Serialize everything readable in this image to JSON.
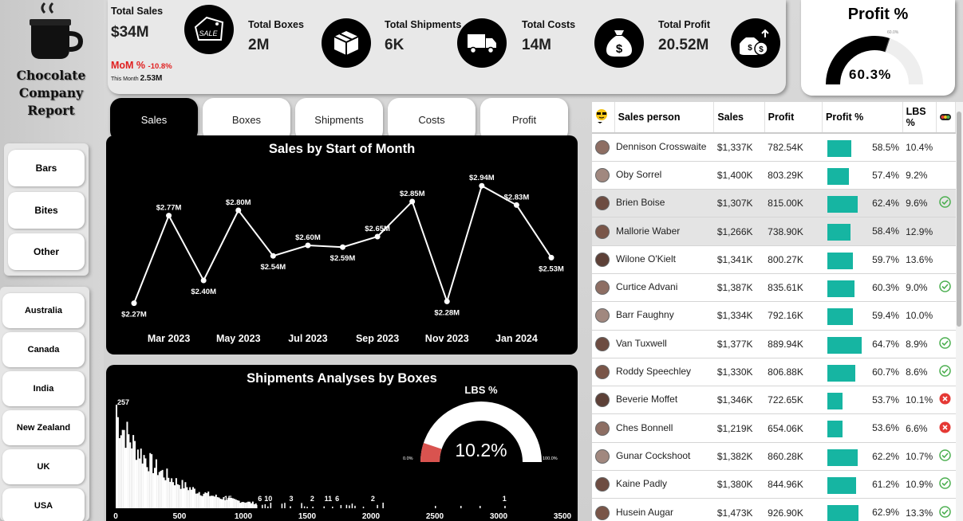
{
  "report": {
    "title_line1": "Chocolate",
    "title_line2": "Company",
    "title_line3": "Report"
  },
  "categories": [
    "Bars",
    "Bites",
    "Other"
  ],
  "countries": [
    "Australia",
    "Canada",
    "India",
    "New Zealand",
    "UK",
    "USA"
  ],
  "kpis": {
    "total_sales_label": "Total Sales",
    "total_sales_value": "$34M",
    "sale_icon_text": "SALE",
    "mom_label": "MoM %",
    "mom_value": "-10.8%",
    "this_month_label": "This Month",
    "this_month_value": "2.53M",
    "total_boxes_label": "Total Boxes",
    "total_boxes_value": "2M",
    "total_shipments_label": "Total Shipments",
    "total_shipments_value": "6K",
    "total_costs_label": "Total Costs",
    "total_costs_value": "14M",
    "total_profit_label": "Total Profit",
    "total_profit_value": "20.52M"
  },
  "profit_gauge": {
    "title": "Profit %",
    "value_label": "60.3%",
    "target_label": "60.0%",
    "value": 0.603
  },
  "tabs": [
    "Sales",
    "Boxes",
    "Shipments",
    "Costs",
    "Profit"
  ],
  "colors": {
    "accent": "#16b5a2",
    "negative": "#e02020",
    "gauge_red": "#d9534f",
    "positive_icon": "#4caf50",
    "negative_icon": "#e53935"
  },
  "chart_data": [
    {
      "type": "line",
      "title": "Sales by Start of Month",
      "x": [
        "Feb 2023",
        "Mar 2023",
        "Apr 2023",
        "May 2023",
        "Jun 2023",
        "Jul 2023",
        "Aug 2023",
        "Sep 2023",
        "Oct 2023",
        "Nov 2023",
        "Dec 2023",
        "Jan 2024",
        "Feb 2024"
      ],
      "values": [
        2.27,
        2.77,
        2.4,
        2.8,
        2.54,
        2.6,
        2.59,
        2.65,
        2.85,
        2.28,
        2.94,
        2.83,
        2.53
      ],
      "data_labels": [
        "$2.27M",
        "$2.77M",
        "$2.40M",
        "$2.80M",
        "$2.54M",
        "$2.60M",
        "$2.59M",
        "$2.65M",
        "$2.85M",
        "$2.28M",
        "$2.94M",
        "$2.83M",
        "$2.53M"
      ],
      "tick_labels": [
        "Mar 2023",
        "May 2023",
        "Jul 2023",
        "Sep 2023",
        "Nov 2023",
        "Jan 2024"
      ],
      "ylim": [
        2.2,
        3.0
      ]
    },
    {
      "type": "bar",
      "title": "Shipments Analyses by Boxes",
      "x_ticks": [
        "0",
        "500",
        "1000",
        "1500",
        "2000",
        "2500",
        "3000",
        "3500"
      ],
      "xlim": [
        0,
        3500
      ],
      "ylim": [
        0,
        257
      ],
      "max_label": "257",
      "value_labels": [
        {
          "x": 880,
          "label": "15"
        },
        {
          "x": 1130,
          "label": "6"
        },
        {
          "x": 1195,
          "label": "10"
        },
        {
          "x": 1375,
          "label": "3"
        },
        {
          "x": 1540,
          "label": "2"
        },
        {
          "x": 1665,
          "label": "11"
        },
        {
          "x": 1735,
          "label": "6"
        },
        {
          "x": 2015,
          "label": "2"
        },
        {
          "x": 3045,
          "label": "1"
        }
      ]
    },
    {
      "type": "gauge",
      "title": "LBS %",
      "value": 0.102,
      "value_label": "10.2%",
      "min_label": "0.0%",
      "max_label": "100.0%"
    }
  ],
  "table": {
    "headers": [
      "Sales person",
      "Sales",
      "Profit",
      "Profit %",
      "LBS %"
    ],
    "rows": [
      {
        "name": "Dennison Crosswaite",
        "sales": "$1,337K",
        "profit": "782.54K",
        "profit_pct": "58.5%",
        "pct": 0.585,
        "lbs": "10.4%",
        "status": "none"
      },
      {
        "name": "Oby Sorrel",
        "sales": "$1,400K",
        "profit": "803.29K",
        "profit_pct": "57.4%",
        "pct": 0.574,
        "lbs": "9.2%",
        "status": "none"
      },
      {
        "name": "Brien Boise",
        "sales": "$1,307K",
        "profit": "815.00K",
        "profit_pct": "62.4%",
        "pct": 0.624,
        "lbs": "9.6%",
        "status": "good"
      },
      {
        "name": "Mallorie Waber",
        "sales": "$1,266K",
        "profit": "738.90K",
        "profit_pct": "58.4%",
        "pct": 0.584,
        "lbs": "12.9%",
        "status": "none"
      },
      {
        "name": "Wilone O'Kielt",
        "sales": "$1,341K",
        "profit": "800.27K",
        "profit_pct": "59.7%",
        "pct": 0.597,
        "lbs": "13.6%",
        "status": "none"
      },
      {
        "name": "Curtice Advani",
        "sales": "$1,387K",
        "profit": "835.61K",
        "profit_pct": "60.3%",
        "pct": 0.603,
        "lbs": "9.0%",
        "status": "good"
      },
      {
        "name": "Barr Faughny",
        "sales": "$1,334K",
        "profit": "792.16K",
        "profit_pct": "59.4%",
        "pct": 0.594,
        "lbs": "10.0%",
        "status": "none"
      },
      {
        "name": "Van Tuxwell",
        "sales": "$1,377K",
        "profit": "889.94K",
        "profit_pct": "64.7%",
        "pct": 0.647,
        "lbs": "8.9%",
        "status": "good"
      },
      {
        "name": "Roddy Speechley",
        "sales": "$1,330K",
        "profit": "806.88K",
        "profit_pct": "60.7%",
        "pct": 0.607,
        "lbs": "8.6%",
        "status": "good"
      },
      {
        "name": "Beverie Moffet",
        "sales": "$1,346K",
        "profit": "722.65K",
        "profit_pct": "53.7%",
        "pct": 0.537,
        "lbs": "10.1%",
        "status": "bad"
      },
      {
        "name": "Ches Bonnell",
        "sales": "$1,219K",
        "profit": "654.06K",
        "profit_pct": "53.6%",
        "pct": 0.536,
        "lbs": "6.6%",
        "status": "bad"
      },
      {
        "name": "Gunar Cockshoot",
        "sales": "$1,382K",
        "profit": "860.28K",
        "profit_pct": "62.2%",
        "pct": 0.622,
        "lbs": "10.7%",
        "status": "good"
      },
      {
        "name": "Kaine Padly",
        "sales": "$1,380K",
        "profit": "844.96K",
        "profit_pct": "61.2%",
        "pct": 0.612,
        "lbs": "10.9%",
        "status": "good"
      },
      {
        "name": "Husein Augar",
        "sales": "$1,473K",
        "profit": "926.90K",
        "profit_pct": "62.9%",
        "pct": 0.629,
        "lbs": "13.3%",
        "status": "good"
      }
    ]
  }
}
